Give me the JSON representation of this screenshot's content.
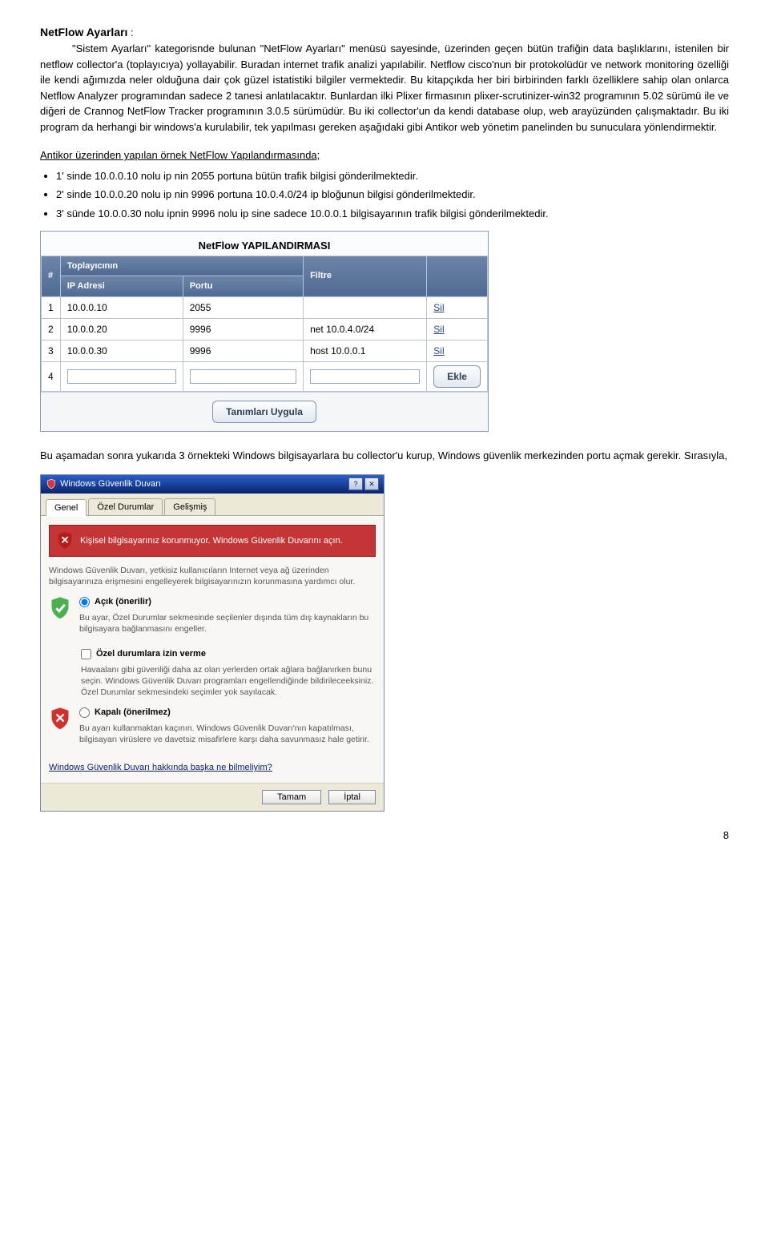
{
  "doc": {
    "title": "NetFlow Ayarları",
    "colon": " :",
    "intro_indent": "\"Sistem Ayarları\" kategorisnde bulunan \"NetFlow Ayarları\" menüsü sayesinde,",
    "intro_rest": "üzerinden geçen bütün trafiğin data başlıklarını, istenilen bir netflow collector'a (toplayıcıya) yollayabilir. Buradan internet trafik analizi yapılabilir. Netflow cisco'nun bir protokolüdür ve network monitoring özelliği ile kendi ağımızda neler olduğuna dair çok güzel istatistiki bilgiler vermektedir. Bu kitapçıkda her biri birbirinden farklı özelliklere sahip olan onlarca Netflow Analyzer programından sadece 2 tanesi anlatılacaktır. Bunlardan ilki Plixer firmasının plixer-scrutinizer-win32 programının 5.02 sürümü ile  ve diğeri de Crannog NetFlow Tracker programının 3.0.5 sürümüdür. Bu iki collector'un da kendi database olup, web arayüzünden çalışmaktadır. Bu iki program da herhangi bir windows'a kurulabilir, tek yapılması gereken aşağıdaki gibi Antikor web yönetim panelinden bu sunuculara yönlendirmektir.",
    "subheading": " Antikor üzerinden yapılan örnek NetFlow Yapılandırmasında;",
    "bullets": [
      "1' sinde 10.0.0.10 nolu ip nin 2055 portuna bütün trafik bilgisi gönderilmektedir.",
      "2' sinde 10.0.0.20 nolu ip nin 9996 portuna 10.0.4.0/24 ip bloğunun bilgisi gönderilmektedir.",
      "3' sünde 10.0.0.30 nolu ipnin 9996 nolu ip sine sadece 10.0.0.1 bilgisayarının trafik bilgisi gönderilmektedir."
    ],
    "after_panel": "Bu aşamadan sonra yukarıda 3 örnekteki Windows bilgisayarlara bu collector'u kurup, Windows güvenlik merkezinden portu açmak gerekir. Sırasıyla,",
    "page_number": "8"
  },
  "nf": {
    "title": "NetFlow YAPILANDIRMASI",
    "headers": {
      "num": "#",
      "group": "Toplayıcının",
      "ip": "IP Adresi",
      "port": "Portu",
      "filter": "Filtre",
      "blank": ""
    },
    "rows": [
      {
        "n": "1",
        "ip": "10.0.0.10",
        "port": "2055",
        "filter": "",
        "action": "Sil"
      },
      {
        "n": "2",
        "ip": "10.0.0.20",
        "port": "9996",
        "filter": "net 10.0.4.0/24",
        "action": "Sil"
      },
      {
        "n": "3",
        "ip": "10.0.0.30",
        "port": "9996",
        "filter": "host 10.0.0.1",
        "action": "Sil"
      }
    ],
    "empty_row_n": "4",
    "add_btn": "Ekle",
    "apply_btn": "Tanımları Uygula"
  },
  "wf": {
    "title": "Windows Güvenlik Duvarı",
    "tabs": {
      "general": "Genel",
      "exceptions": "Özel Durumlar",
      "advanced": "Gelişmiş"
    },
    "banner": "Kişisel bilgisayarınız korunmuyor. Windows Güvenlik Duvarını açın.",
    "desc": "Windows Güvenlik Duvarı, yetkisiz kullanıcıların Internet veya ağ üzerinden bilgisayarınıza erişmesini engelleyerek bilgisayarınızın korunmasına yardımcı olur.",
    "opt_on": "Açık (önerilir)",
    "opt_on_sub": "Bu ayar, Özel Durumlar sekmesinde seçilenler dışında tüm dış kaynakların bu bilgisayara bağlanmasını engeller.",
    "cb": "Özel durumlara izin verme",
    "cb_sub": "Havaalanı gibi güvenliği daha az olan yerlerden ortak ağlara bağlanırken bunu seçin. Windows Güvenlik Duvarı programları engellendiğinde bildirileceeksiniz. Özel Durumlar sekmesindeki seçimler yok sayılacak.",
    "opt_off": "Kapalı (önerilmez)",
    "opt_off_sub": "Bu ayarı kullanmaktan kaçının. Windows Güvenlik Duvarı'nın kapatılması, bilgisayarı virüslere ve davetsiz misafirlere karşı daha savunmasız hale getirir.",
    "link": "Windows Güvenlik Duvarı hakkında başka ne bilmeliyim?",
    "ok": "Tamam",
    "cancel": "İptal"
  }
}
